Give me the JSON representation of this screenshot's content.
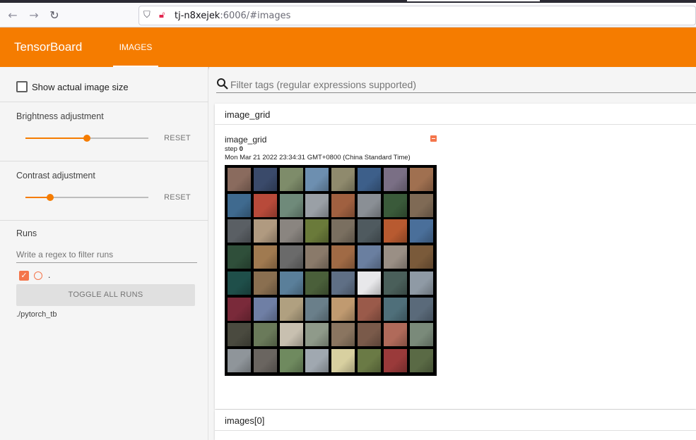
{
  "browser": {
    "url_host": "tj-n8xejek",
    "url_rest": ":6006/#images",
    "icons": [
      "back-arrow-icon",
      "forward-arrow-icon",
      "reload-icon",
      "shield-icon",
      "lock-warning-icon"
    ]
  },
  "header": {
    "brand": "TensorBoard",
    "tabs": [
      {
        "label": "IMAGES",
        "active": true
      }
    ],
    "accent": "#f57c00"
  },
  "sidebar": {
    "show_actual_size_label": "Show actual image size",
    "show_actual_size_checked": false,
    "brightness": {
      "title": "Brightness adjustment",
      "reset_label": "RESET",
      "value": 0.5
    },
    "contrast": {
      "title": "Contrast adjustment",
      "reset_label": "RESET",
      "value": 0.2
    },
    "runs": {
      "title": "Runs",
      "filter_placeholder": "Write a regex to filter runs",
      "run_items": [
        {
          "label": ".",
          "checked": true,
          "color": "#f4754b"
        }
      ],
      "toggle_all_label": "TOGGLE ALL RUNS",
      "logdir": "./pytorch_tb"
    }
  },
  "main": {
    "filter_placeholder": "Filter tags (regular expressions supported)",
    "cards": [
      {
        "header": "image_grid",
        "image": {
          "tag": "image_grid",
          "step_label": "step",
          "step_value": "0",
          "timestamp": "Mon Mar 21 2022 23:34:31 GMT+0800 (China Standard Time)",
          "grid_rows": 8,
          "grid_cols": 8,
          "tile_colors": [
            "#8a6b5e",
            "#3a4a6a",
            "#7e8c6a",
            "#6d8fb0",
            "#8f8a6d",
            "#3d5f8a",
            "#7a6f85",
            "#a07050",
            "#3f6a8f",
            "#b84a3a",
            "#6f8a7a",
            "#9aa0a6",
            "#a06040",
            "#8a8f95",
            "#3a5a3a",
            "#7f6a55",
            "#5a5f64",
            "#b09a80",
            "#8a8580",
            "#6a7a3a",
            "#7a6f60",
            "#4f5a5f",
            "#b85a30",
            "#4a6f9a",
            "#2f4f3a",
            "#a07a50",
            "#6a6a6a",
            "#8a7a6a",
            "#a06a45",
            "#6a7fa0",
            "#9a8f85",
            "#7a5a3a",
            "#1f4f4a",
            "#8a6f50",
            "#5a7f9a",
            "#4a5f3a",
            "#5f6f85",
            "#e8e8ea",
            "#4a5f5a",
            "#8f9aa5",
            "#7a2a3a",
            "#6f7fa5",
            "#b0a080",
            "#6a7f8a",
            "#c09a70",
            "#9a5a4a",
            "#4f6f7a",
            "#5a6a7a",
            "#4a4a3f",
            "#6a7a5a",
            "#c8c0b0",
            "#8f9a8a",
            "#8a7560",
            "#7a5a4a",
            "#b06a5a",
            "#7a8a7a",
            "#8f959a",
            "#6a6560",
            "#6f8a5f",
            "#a0a8b0",
            "#d8d0a0",
            "#6a7a45",
            "#9a3a3a",
            "#5a6a45"
          ]
        }
      },
      {
        "header": "images[0]"
      }
    ]
  }
}
